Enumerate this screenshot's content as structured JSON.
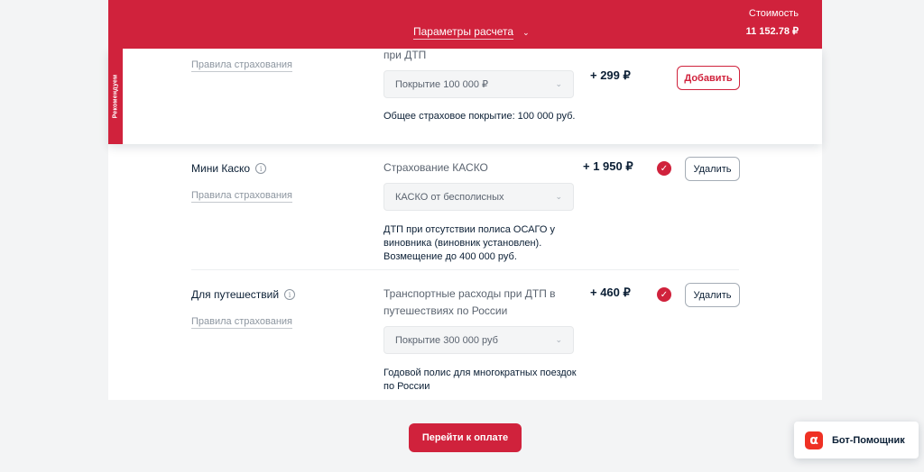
{
  "header": {
    "params_label": "Параметры расчета",
    "cost_label": "Стоимость",
    "cost_value": "11 152.78 ₽"
  },
  "recommended": {
    "badge": "Рекомендуем",
    "rules_link": "Правила страхования",
    "desc_top": "при ДТП",
    "select_value": "Покрытие 100 000 ₽",
    "note": "Общее страховое покрытие: 100 000 руб.",
    "price": "+ 299 ₽",
    "button": "Добавить"
  },
  "items": [
    {
      "title": "Мини Каско",
      "rules_link": "Правила страхования",
      "desc_top": "Страхование КАСКО",
      "select_value": "КАСКО от бесполисных",
      "note": "ДТП при отсутствии полиса ОСАГО у виновника (виновник установлен). Возмещение до 400 000 руб.",
      "price": "+ 1 950 ₽",
      "button": "Удалить"
    },
    {
      "title": "Для путешествий",
      "rules_link": "Правила страхования",
      "desc_top": "Транспортные расходы при ДТП в путешествиях по России",
      "select_value": "Покрытие 300 000 руб",
      "note": "Годовой полис для многократных поездок по России",
      "price": "+ 460 ₽",
      "button": "Удалить"
    }
  ],
  "footer": {
    "pay_button": "Перейти к оплате"
  },
  "bot": {
    "logo": "α",
    "label": "Бот-Помощник"
  },
  "colors": {
    "brand": "#d0223c",
    "text": "#0b1f35",
    "muted": "#8d96a0"
  },
  "icons": {
    "info": "info-icon",
    "check": "checkmark-icon",
    "chevron": "chevron-down-icon"
  }
}
